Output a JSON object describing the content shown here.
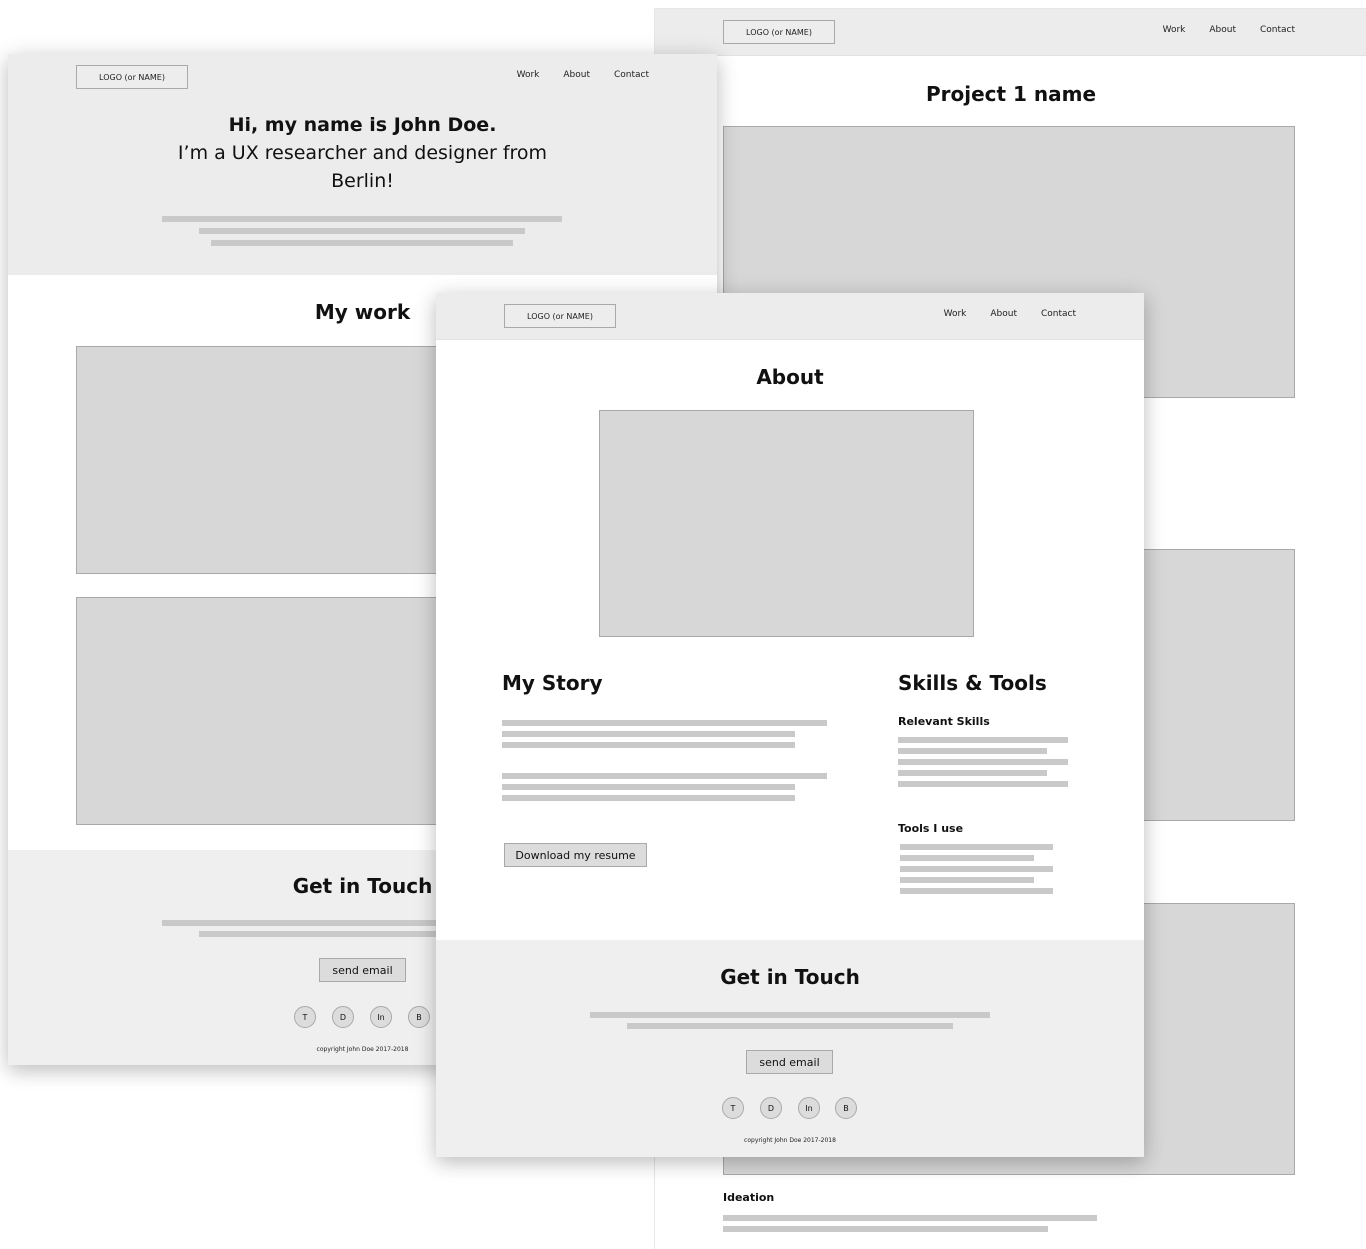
{
  "nav": {
    "logo": "LOGO (or NAME)",
    "links": [
      "Work",
      "About",
      "Contact"
    ]
  },
  "home": {
    "hero_title": "Hi, my name is John Doe.",
    "hero_subtitle_line1": "I’m a UX researcher and designer from",
    "hero_subtitle_line2": "Berlin!",
    "work_heading": "My work",
    "contact_heading": "Get in Touch",
    "send_email": "send email",
    "socials": [
      "T",
      "D",
      "In",
      "B"
    ],
    "copyright": "copyright John Doe 2017-2018"
  },
  "project": {
    "title": "Project 1 name",
    "section_ideation": "Ideation"
  },
  "about": {
    "title": "About",
    "story_heading": "My Story",
    "download_button": "Download my resume",
    "skills_heading": "Skills & Tools",
    "relevant_skills": "Relevant Skills",
    "tools_heading": "Tools I use",
    "contact_heading": "Get in Touch",
    "send_email": "send email",
    "socials": [
      "T",
      "D",
      "In",
      "B"
    ],
    "copyright": "copyright John Doe 2017-2018"
  }
}
